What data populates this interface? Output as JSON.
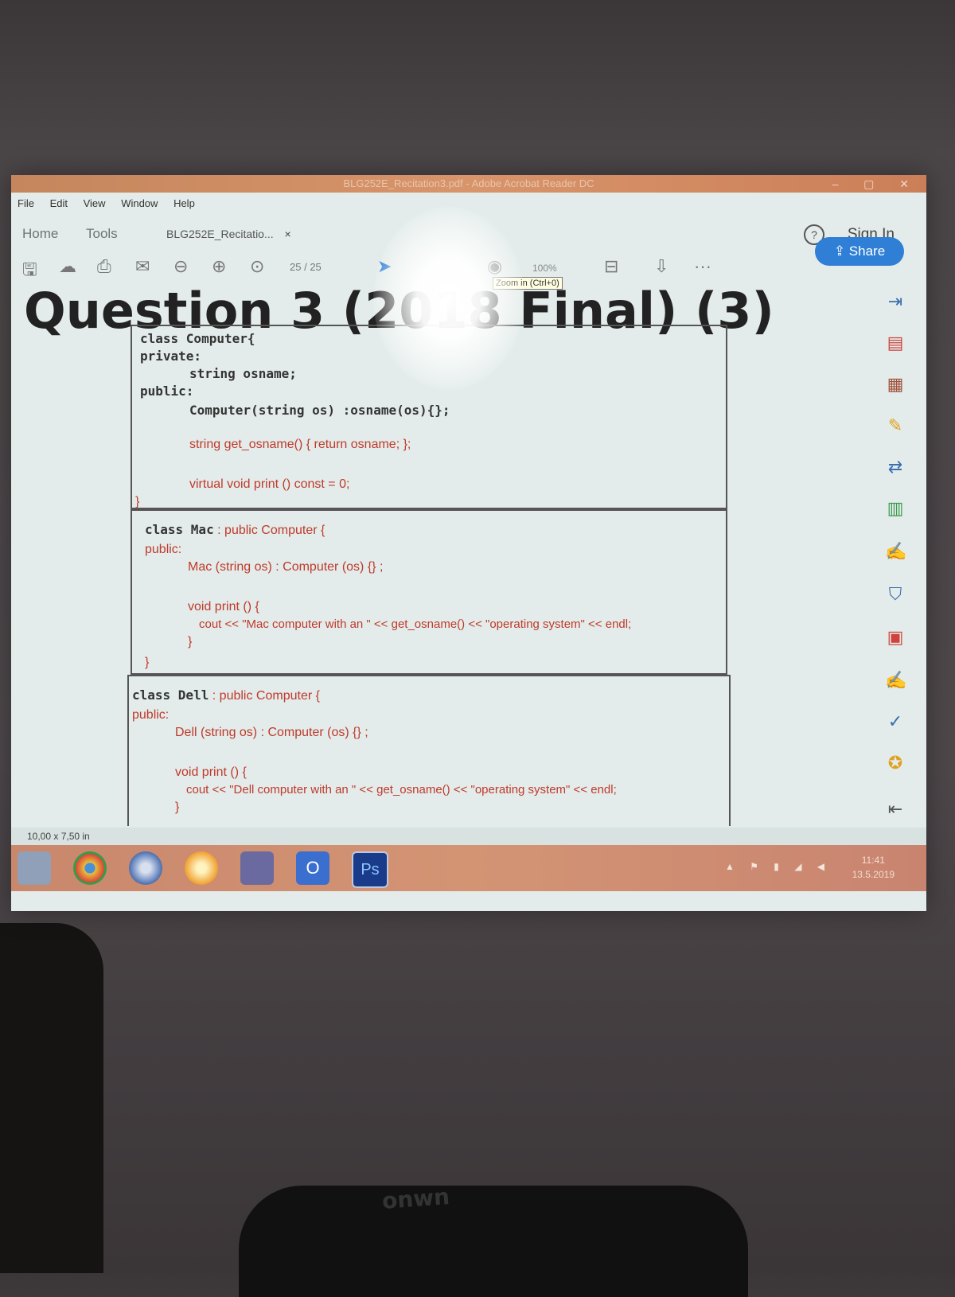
{
  "window": {
    "title": "BLG252E_Recitation3.pdf - Adobe Acrobat Reader DC"
  },
  "menu": [
    "File",
    "Edit",
    "View",
    "Window",
    "Help"
  ],
  "tabs": {
    "home": "Home",
    "tools": "Tools",
    "document": "BLG252E_Recitatio...",
    "close": "×"
  },
  "account": {
    "help": "?",
    "sign_in": "Sign In",
    "share": "Share"
  },
  "toolbar": {
    "page_current": "25",
    "page_total": "/ 25",
    "zoom": "100%",
    "tooltip": "Zoom in (Ctrl+0)",
    "more": "···"
  },
  "document": {
    "heading": "Question 3 (2018 Final) (3)",
    "class_computer": {
      "l1": "class Computer{",
      "l2": "private:",
      "l3": "string osname;",
      "l4": "public:",
      "l5": "Computer(string os) :osname(os){};",
      "l6": "string get_osname() { return osname; };",
      "l7": "virtual void print () const = 0;",
      "l8": "}"
    },
    "class_mac": {
      "l1a": "class Mac",
      "l1b": " : public Computer {",
      "l2": "public:",
      "l3": "Mac (string os) : Computer (os) {} ;",
      "l4": "void print () {",
      "l5": "cout << \"Mac computer with an \" << get_osname() << \"operating system\" << endl;",
      "l6": "}",
      "l7": "}"
    },
    "class_dell": {
      "l1a": "class Dell",
      "l1b": " : public Computer {",
      "l2": "public:",
      "l3": "Dell (string os) : Computer (os) {} ;",
      "l4": "void print () {",
      "l5": "cout << \"Dell computer with an \" << get_osname() << \"operating system\" << endl;",
      "l6": "}"
    }
  },
  "status": {
    "page_size": "10,00 x 7,50 in"
  },
  "taskbar": {
    "time": "11:41",
    "date": "13.5.2019",
    "outlook": "O",
    "photoshop": "Ps"
  },
  "bag": {
    "brand": "onwn"
  }
}
